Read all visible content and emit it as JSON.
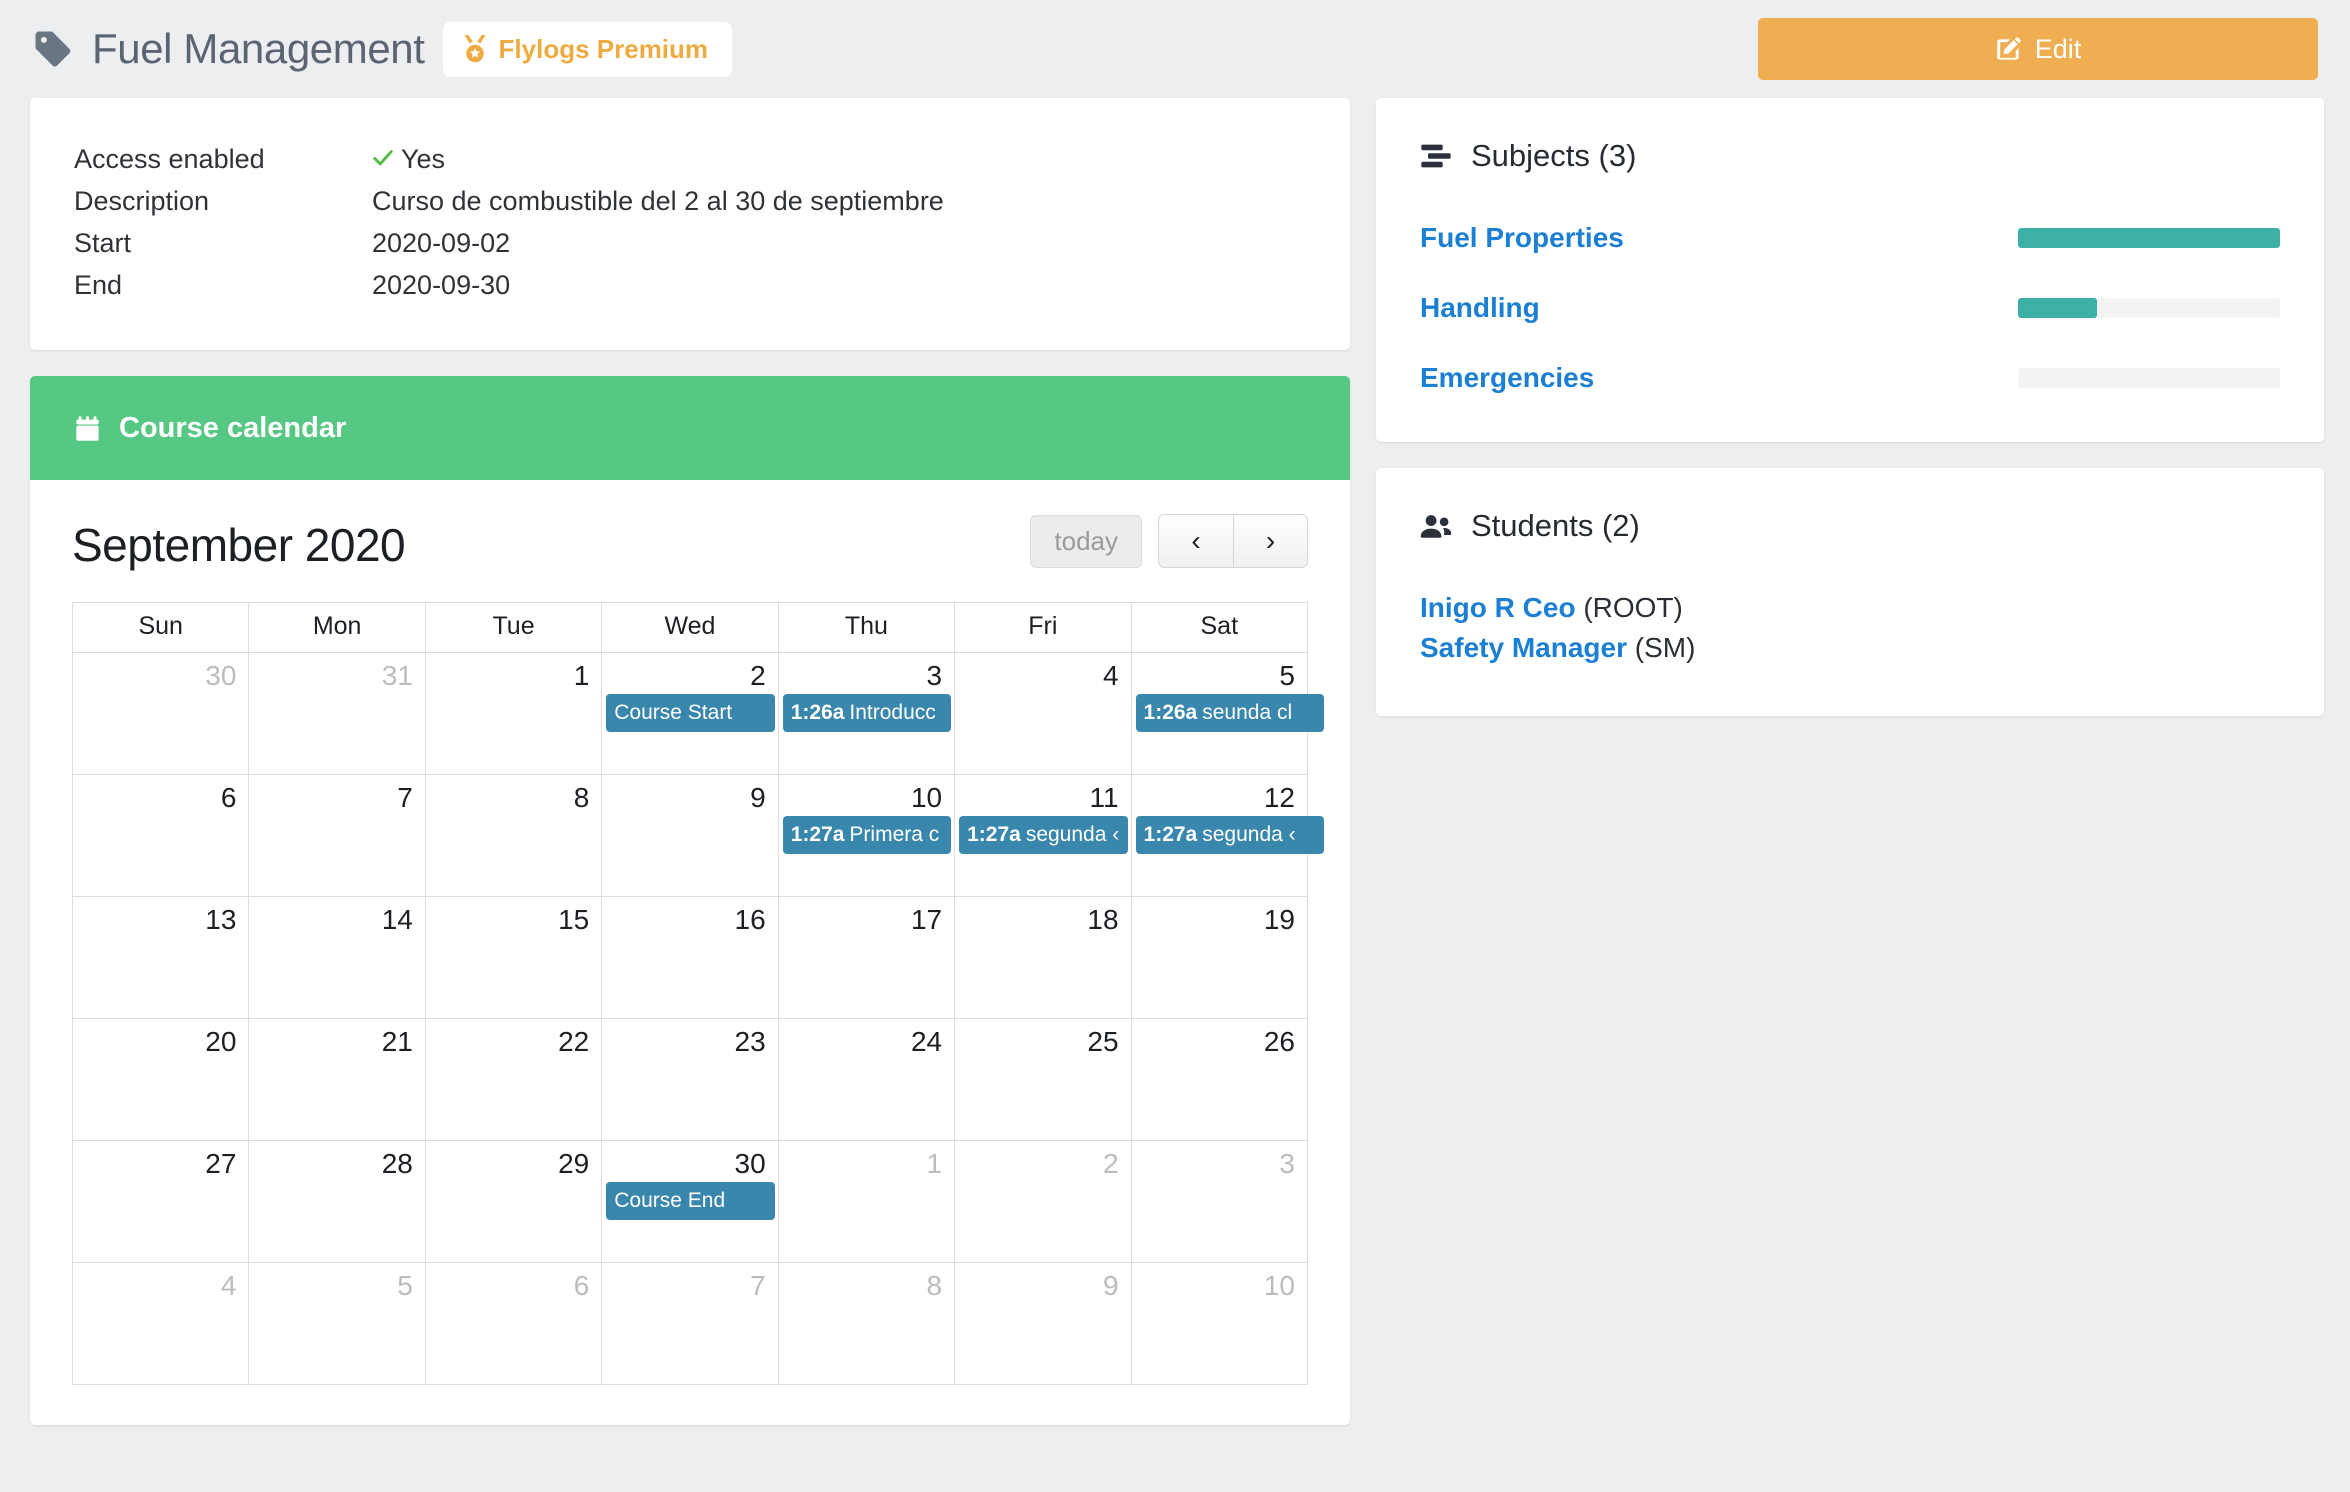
{
  "header": {
    "tag_icon": "tag-icon",
    "title": "Fuel Management",
    "premium_badge": {
      "icon": "medal-icon",
      "label": "Flylogs Premium"
    },
    "edit_button": {
      "icon": "pencil-square-icon",
      "label": "Edit"
    }
  },
  "info": {
    "rows": [
      {
        "label": "Access enabled",
        "value": "Yes",
        "icon": "check-icon"
      },
      {
        "label": "Description",
        "value": "Curso de combustible del 2 al 30 de septiembre"
      },
      {
        "label": "Start",
        "value": "2020-09-02"
      },
      {
        "label": "End",
        "value": "2020-09-30"
      }
    ]
  },
  "calendar": {
    "header_icon": "calendar-icon",
    "header_title": "Course calendar",
    "month_title": "September 2020",
    "today_label": "today",
    "prev_label": "‹",
    "next_label": "›",
    "weekdays": [
      "Sun",
      "Mon",
      "Tue",
      "Wed",
      "Thu",
      "Fri",
      "Sat"
    ],
    "weeks": [
      [
        {
          "day": "30",
          "other": true,
          "events": []
        },
        {
          "day": "31",
          "other": true,
          "events": []
        },
        {
          "day": "1",
          "events": []
        },
        {
          "day": "2",
          "events": [
            {
              "time": "",
              "text": "Course Start"
            }
          ]
        },
        {
          "day": "3",
          "events": [
            {
              "time": "1:26a",
              "text": "Introducc"
            }
          ]
        },
        {
          "day": "4",
          "events": []
        },
        {
          "day": "5",
          "events": [
            {
              "time": "1:26a",
              "text": "seunda cl",
              "overflow": true
            }
          ]
        }
      ],
      [
        {
          "day": "6",
          "events": []
        },
        {
          "day": "7",
          "events": []
        },
        {
          "day": "8",
          "events": []
        },
        {
          "day": "9",
          "today": true,
          "events": []
        },
        {
          "day": "10",
          "events": [
            {
              "time": "1:27a",
              "text": "Primera c"
            }
          ]
        },
        {
          "day": "11",
          "events": [
            {
              "time": "1:27a",
              "text": "segunda ‹"
            }
          ]
        },
        {
          "day": "12",
          "events": [
            {
              "time": "1:27a",
              "text": "segunda ‹",
              "overflow": true
            }
          ]
        }
      ],
      [
        {
          "day": "13",
          "events": []
        },
        {
          "day": "14",
          "events": []
        },
        {
          "day": "15",
          "events": []
        },
        {
          "day": "16",
          "events": []
        },
        {
          "day": "17",
          "events": []
        },
        {
          "day": "18",
          "events": []
        },
        {
          "day": "19",
          "events": []
        }
      ],
      [
        {
          "day": "20",
          "events": []
        },
        {
          "day": "21",
          "events": []
        },
        {
          "day": "22",
          "events": []
        },
        {
          "day": "23",
          "events": []
        },
        {
          "day": "24",
          "events": []
        },
        {
          "day": "25",
          "events": []
        },
        {
          "day": "26",
          "events": []
        }
      ],
      [
        {
          "day": "27",
          "events": []
        },
        {
          "day": "28",
          "events": []
        },
        {
          "day": "29",
          "events": []
        },
        {
          "day": "30",
          "events": [
            {
              "time": "",
              "text": "Course End"
            }
          ]
        },
        {
          "day": "1",
          "other": true,
          "events": []
        },
        {
          "day": "2",
          "other": true,
          "events": []
        },
        {
          "day": "3",
          "other": true,
          "events": []
        }
      ],
      [
        {
          "day": "4",
          "other": true,
          "events": []
        },
        {
          "day": "5",
          "other": true,
          "events": []
        },
        {
          "day": "6",
          "other": true,
          "events": []
        },
        {
          "day": "7",
          "other": true,
          "events": []
        },
        {
          "day": "8",
          "other": true,
          "events": []
        },
        {
          "day": "9",
          "other": true,
          "events": []
        },
        {
          "day": "10",
          "other": true,
          "events": []
        }
      ]
    ]
  },
  "subjects": {
    "icon": "stream-icon",
    "title": "Subjects (3)",
    "items": [
      {
        "name": "Fuel Properties",
        "progress": 100
      },
      {
        "name": "Handling",
        "progress": 30
      },
      {
        "name": "Emergencies",
        "progress": 0
      }
    ]
  },
  "students": {
    "icon": "users-icon",
    "title": "Students (2)",
    "items": [
      {
        "name": "Inigo R Ceo",
        "role": " (ROOT)"
      },
      {
        "name": "Safety Manager",
        "role": " (SM)"
      }
    ]
  },
  "colors": {
    "page_bg": "#eceef0",
    "accent_green": "#57c784",
    "accent_orange": "#efae51",
    "premium_orange": "#eeab3f",
    "event_blue": "#3a87ad",
    "link_blue": "#1b7fd4",
    "progress_teal": "#3cb0a5",
    "today_bg": "#fcf8e3",
    "check_green": "#59bb46"
  }
}
